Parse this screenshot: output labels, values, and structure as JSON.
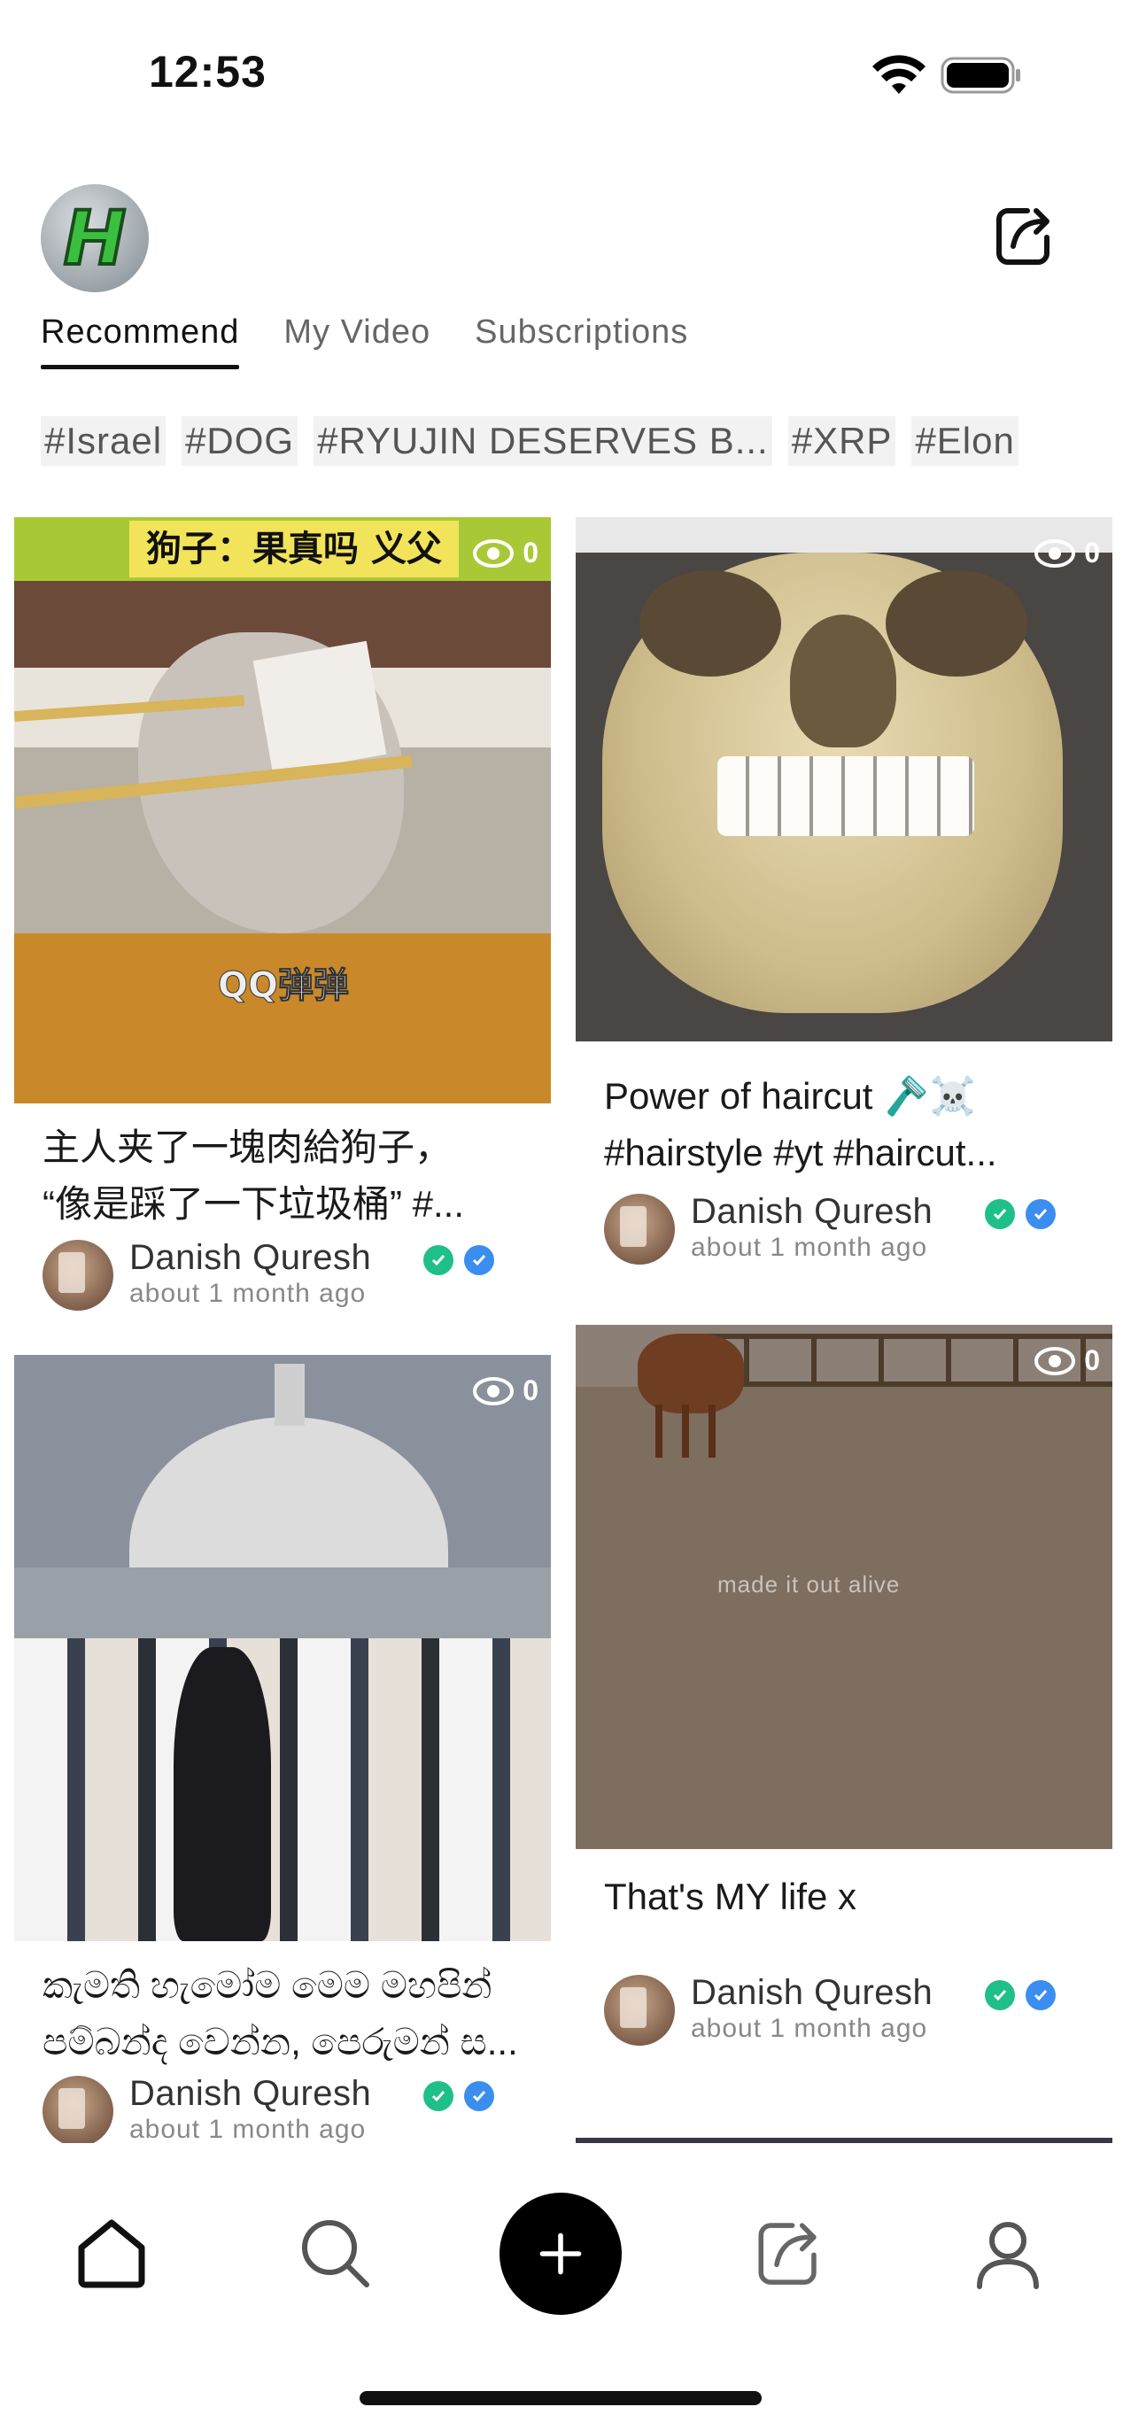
{
  "status_bar": {
    "time": "12:53"
  },
  "tabs": [
    {
      "label": "Recommend",
      "active": true
    },
    {
      "label": "My Video",
      "active": false
    },
    {
      "label": "Subscriptions",
      "active": false
    }
  ],
  "hashtags": [
    "#Israel",
    "#DOG",
    "#RYUJIN DESERVES B...",
    "#XRP",
    "#Elon"
  ],
  "feed": [
    {
      "views": "0",
      "overlay_banner": "狗子：果真吗 义父",
      "overlay_subtitle": "QQ弹弹",
      "caption_line1": "主人夹了一塊肉給狗子，",
      "caption_line2": "“像是踩了一下垃圾桶” #...",
      "author": "Danish Quresh",
      "time": "about 1 month ago"
    },
    {
      "views": "0",
      "caption_line1": "Power of haircut 🪒☠️",
      "caption_line2": "#hairstyle #yt #haircut...",
      "author": "Danish Quresh",
      "time": "about 1 month ago"
    },
    {
      "views": "0",
      "caption_line1": "කැමති හැමෝම මෙම මහපින්",
      "caption_line2": "පම්බන්ද වෙන්න, පෙරුමන් ස...",
      "author": "Danish Quresh",
      "time": "about 1 month ago"
    },
    {
      "views": "0",
      "overlay_subtitle": "made it out alive",
      "caption_line1": "That's MY life x",
      "author": "Danish Quresh",
      "time": "about 1 month ago"
    }
  ],
  "colors": {
    "verified_green": "#1fbf8a",
    "verified_blue": "#3b8ef0",
    "add_button": "#000000"
  },
  "icons": {
    "top_right": "share-icon",
    "nav": [
      "home-icon",
      "search-icon",
      "plus-icon",
      "share-icon",
      "profile-icon"
    ]
  }
}
